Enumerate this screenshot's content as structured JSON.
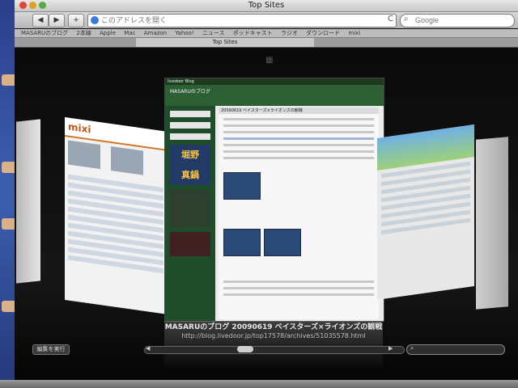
{
  "window": {
    "title": "Top Sites"
  },
  "toolbar": {
    "back": "◀",
    "forward": "▶",
    "add": "+",
    "address_placeholder": "このアドレスを開く",
    "reload": "C",
    "search_placeholder": "Google"
  },
  "bookmarks": {
    "items": [
      "MASARUのブログ",
      "2本線",
      "Apple",
      "Mac",
      "Amazon",
      "Yahoo!",
      "ニュース",
      "ポッドキャスト",
      "ラジオ",
      "ダウンロード",
      "mixi"
    ]
  },
  "tabs": [
    {
      "label": "Top Sites"
    }
  ],
  "center_page": {
    "topbar": "livedoor Blog",
    "blog_title": "MASARUのブログ",
    "entry_title": "20090619 ベイスターズ×ライオンズの観戦",
    "banner_line1": "堀野",
    "banner_line2": "真鍋"
  },
  "left_page": {
    "site_logo": "mixi"
  },
  "caption": {
    "title": "MASARUのブログ 20090619 ベイスターズ×ライオンズの観戦",
    "url": "http://blog.livedoor.jp/top17578/archives/51035578.html"
  },
  "bottom": {
    "edit_label": "編集を実行"
  },
  "colors": {
    "blog_green": "#2d5f35",
    "mixi_orange": "#d1782a"
  }
}
